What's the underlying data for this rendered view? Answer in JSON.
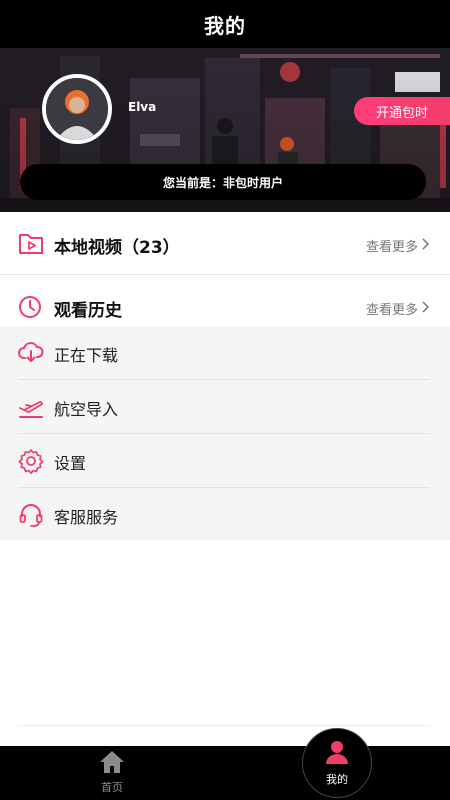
{
  "header": {
    "title": "我的"
  },
  "profile": {
    "username": "Elva",
    "open_button": "开通包时",
    "status": "您当前是：非包时用户"
  },
  "local_videos": {
    "label": "本地视频（23）",
    "more": "查看更多",
    "icon": "folder-play-icon"
  },
  "history": {
    "label": "观看历史",
    "more": "查看更多",
    "icon": "clock-icon"
  },
  "menu": [
    {
      "label": "正在下载",
      "icon": "cloud-download-icon"
    },
    {
      "label": "航空导入",
      "icon": "airplane-icon"
    },
    {
      "label": "设置",
      "icon": "gear-icon"
    },
    {
      "label": "客服服务",
      "icon": "headset-icon"
    }
  ],
  "tabbar": {
    "home": {
      "label": "首页",
      "icon": "home-icon"
    },
    "me": {
      "label": "我的",
      "icon": "person-icon"
    }
  },
  "colors": {
    "accent": "#f23d6a",
    "bar": "#000000",
    "menu_bg": "#f5f5f5"
  }
}
